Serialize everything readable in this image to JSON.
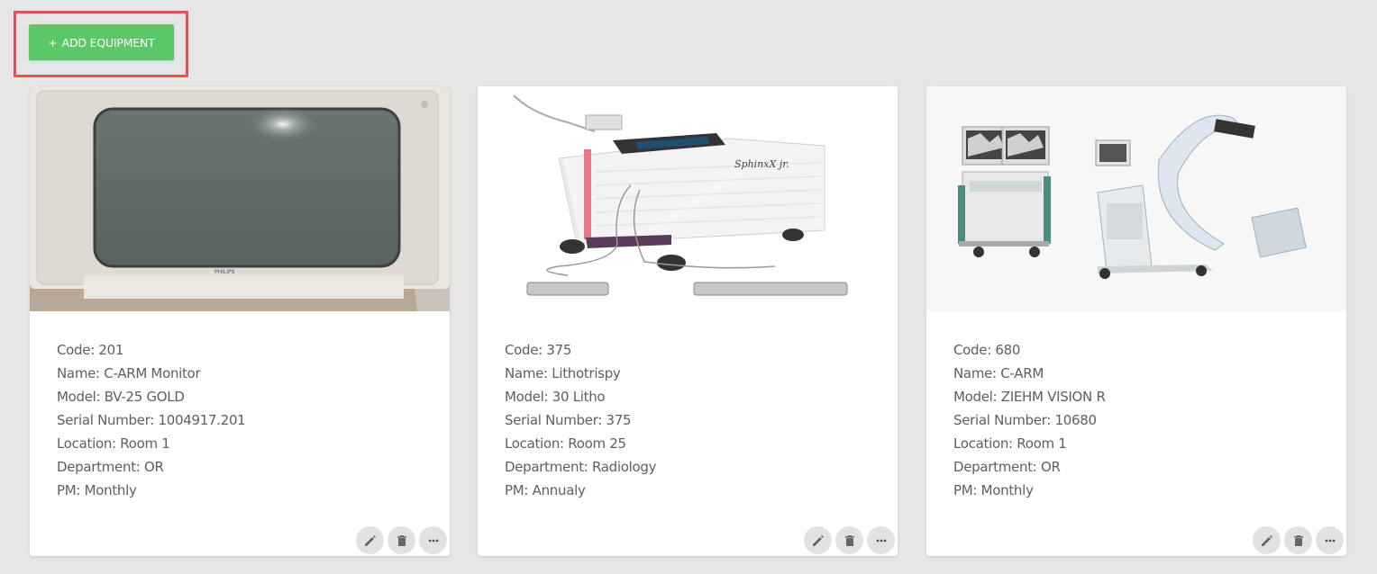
{
  "toolbar": {
    "add_label": "ADD EQUIPMENT",
    "add_icon": "+"
  },
  "colors": {
    "accent_green": "#5cc767",
    "highlight_red": "#e0515a",
    "background": "#e6e6e6"
  },
  "cards": [
    {
      "code": "Code: 201",
      "name": "Name: C-ARM Monitor",
      "model": "Model: BV-25 GOLD",
      "serial": "Serial Number: 1004917.201",
      "location": "Location: Room 1",
      "department": "Department: OR",
      "pm": "PM: Monthly",
      "image_icon": "crt-monitor-image"
    },
    {
      "code": "Code: 375",
      "name": "Name: Lithotrispy",
      "model": "Model: 30 Litho",
      "serial": "Serial Number: 375",
      "location": "Location: Room 25",
      "department": "Department: Radiology",
      "pm": "PM: Annualy",
      "image_icon": "lithotripter-image"
    },
    {
      "code": "Code: 680",
      "name": "Name: C-ARM",
      "model": "Model: ZIEHM VISION R",
      "serial": "Serial Number: 10680",
      "location": "Location: Room 1",
      "department": "Department: OR",
      "pm": "PM: Monthly",
      "image_icon": "c-arm-image"
    }
  ],
  "actions": {
    "edit_icon": "pencil-icon",
    "delete_icon": "trash-icon",
    "more_icon": "more-horizontal-icon"
  }
}
